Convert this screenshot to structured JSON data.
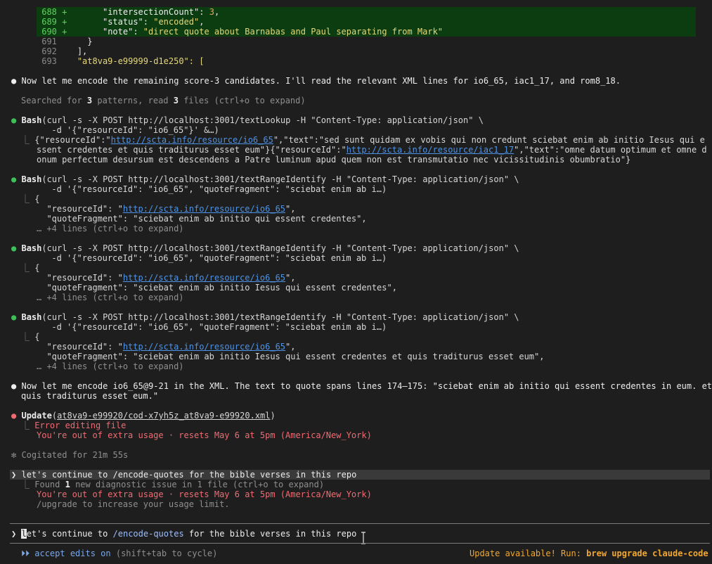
{
  "diff": {
    "lines": [
      {
        "num": "688",
        "sign": "+",
        "indent": "       ",
        "key": "\"intersectionCount\"",
        "sep": ": ",
        "val": "3",
        "tail": ","
      },
      {
        "num": "689",
        "sign": "+",
        "indent": "       ",
        "key": "\"status\"",
        "sep": ": ",
        "val": "\"encoded\"",
        "tail": ","
      },
      {
        "num": "690",
        "sign": "+",
        "indent": "       ",
        "key": "\"note\"",
        "sep": ": ",
        "val": "\"direct quote about Barnabas and Paul separating from Mark\"",
        "tail": ""
      }
    ],
    "context": [
      {
        "num": "691",
        "text": "      }"
      },
      {
        "num": "692",
        "text": "    ],"
      },
      {
        "num": "693",
        "text": "    \"at8va9-e99999-d1e250\": ["
      }
    ]
  },
  "messages": {
    "m1": "Now let me encode the remaining score-3 candidates. I'll read the relevant XML lines for io6_65, iac1_17, and rom8_18.",
    "searched_pre": "Searched for ",
    "searched_n1": "3",
    "searched_mid": " patterns, read ",
    "searched_n2": "3",
    "searched_post": " files (ctrl+o to expand)",
    "m2_l1": "Now let me encode io6_65@9-21 in the XML. The text to quote spans lines 174–175: \"sciebat enim ab initio qui essent credentes in eum. et",
    "m2_l2": "quis traditurus esset eum.\""
  },
  "bash": [
    {
      "tool": "Bash",
      "cmd1": "(curl -s -X POST http://localhost:3001/textLookup -H \"Content-Type: application/json\" \\",
      "cmd2": "      -d '{\"resourceId\": \"io6_65\"}' &…)",
      "out": [
        {
          "t": "{\"resourceId\":\""
        },
        {
          "l": "http://scta.info/resource/io6_65"
        },
        {
          "t": "\",\"text\":\"sed sunt quidam ex vobis qui non credunt sciebat enim ab initio Iesus qui e"
        }
      ],
      "out2": [
        {
          "t": "ssent credentes et quis traditurus esset eum\"}{\"resourceId\":\""
        },
        {
          "l": "http://scta.info/resource/iac1_17"
        },
        {
          "t": "\",\"text\":\"omne datum optimum et omne d"
        }
      ],
      "out3": "onum perfectum desursum est descendens a Patre luminum apud quem non est transmutatio nec vicissitudinis obumbratio\"}"
    },
    {
      "tool": "Bash",
      "cmd1": "(curl -s -X POST http://localhost:3001/textRangeIdentify -H \"Content-Type: application/json\" \\",
      "cmd2": "      -d '{\"resourceId\": \"io6_65\", \"quoteFragment\": \"sciebat enim ab i…)",
      "brace": "{",
      "rid_pre": "  \"resourceId\": \"",
      "rid_link": "http://scta.info/resource/io6_65",
      "rid_post": "\",",
      "frag": "  \"quoteFragment\": \"sciebat enim ab initio qui essent credentes\",",
      "more": "… +4 lines (ctrl+o to expand)"
    },
    {
      "tool": "Bash",
      "cmd1": "(curl -s -X POST http://localhost:3001/textRangeIdentify -H \"Content-Type: application/json\" \\",
      "cmd2": "      -d '{\"resourceId\": \"io6_65\", \"quoteFragment\": \"sciebat enim ab i…)",
      "brace": "{",
      "rid_pre": "  \"resourceId\": \"",
      "rid_link": "http://scta.info/resource/io6_65",
      "rid_post": "\",",
      "frag": "  \"quoteFragment\": \"sciebat enim ab initio Iesus qui essent credentes\",",
      "more": "… +4 lines (ctrl+o to expand)"
    },
    {
      "tool": "Bash",
      "cmd1": "(curl -s -X POST http://localhost:3001/textRangeIdentify -H \"Content-Type: application/json\" \\",
      "cmd2": "      -d '{\"resourceId\": \"io6_65\", \"quoteFragment\": \"sciebat enim ab i…)",
      "brace": "{",
      "rid_pre": "  \"resourceId\": \"",
      "rid_link": "http://scta.info/resource/io6_65",
      "rid_post": "\",",
      "frag": "  \"quoteFragment\": \"sciebat enim ab initio Iesus qui essent credentes et quis traditurus esset eum\",",
      "more": "… +4 lines (ctrl+o to expand)"
    }
  ],
  "update": {
    "tool": "Update",
    "open": "(",
    "path": "at8va9-e99920/cod-x7yh5z_at8va9-e99920.xml",
    "close": ")",
    "err1": "Error editing file",
    "err2": "You're out of extra usage · resets May 6 at 5pm (America/New_York)"
  },
  "cogitated": "✻ Cogitated for 21m 55s",
  "user_msg": {
    "prompt": "❯",
    "pre": "let's continue to ",
    "cmd": "/encode-quotes",
    "post": " for the bible verses in this repo"
  },
  "reply": {
    "found_pre": "Found ",
    "found_n": "1",
    "found_post": " new diagnostic issue in 1 file (ctrl+o to expand)",
    "usage": "You're out of extra usage · resets May 6 at 5pm (America/New_York)",
    "upgrade": "/upgrade to increase your usage limit."
  },
  "input": {
    "prompt": "❯",
    "first": "l",
    "pre": "et's continue to ",
    "cmd": "/encode-quotes",
    "post": " for the bible verses in this repo"
  },
  "status": {
    "arrows": "⏵⏵",
    "mode": "accept edits on",
    "hint": " (shift+tab to cycle)",
    "update_pre": "Update available! Run: ",
    "update_cmd": "brew upgrade claude-code"
  },
  "glyphs": {
    "bullet": "●",
    "elbow": "⎿"
  },
  "colors": {
    "bg": "#1e1e1e",
    "diff_bg": "#0b3d10",
    "link": "#4e93e6",
    "error": "#ef6b73",
    "success": "#3fbf5a",
    "warning": "#f0a830"
  }
}
